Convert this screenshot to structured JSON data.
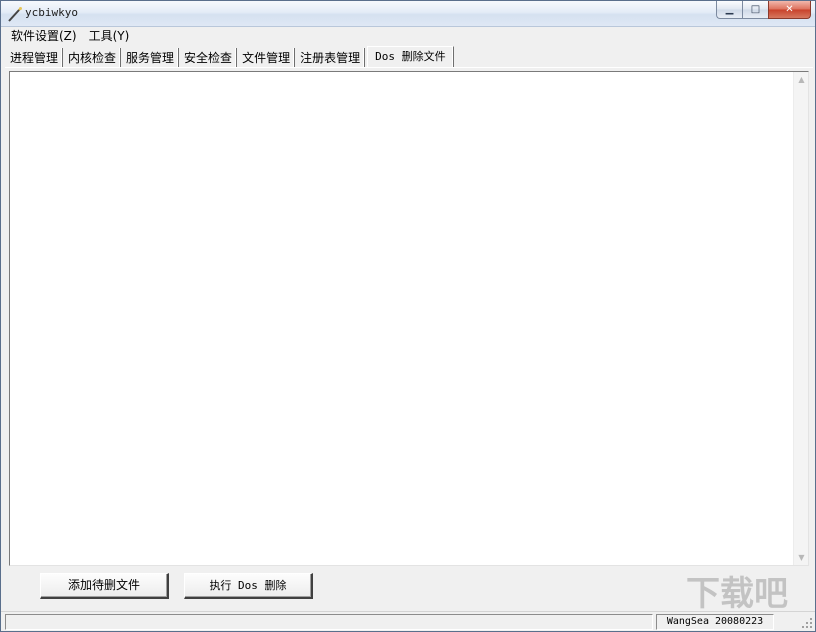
{
  "window": {
    "title": "ycbiwkyo",
    "accent": "#d5e1f0",
    "close_color": "#c8412a"
  },
  "caption_buttons": {
    "minimize_icon": "minimize-icon",
    "maximize_icon": "maximize-icon",
    "close_icon": "close-icon",
    "minimize_glyph": "▁",
    "maximize_glyph": "□",
    "close_glyph": "✕"
  },
  "menu": {
    "items": [
      {
        "label": "软件设置(Z)"
      },
      {
        "label": "工具(Y)"
      }
    ]
  },
  "tabs": [
    {
      "label": "进程管理"
    },
    {
      "label": "内核检查"
    },
    {
      "label": "服务管理"
    },
    {
      "label": "安全检查"
    },
    {
      "label": "文件管理"
    },
    {
      "label": "注册表管理"
    },
    {
      "label": "Dos 删除文件",
      "active": true
    }
  ],
  "actions": {
    "add_label": "添加待删文件",
    "execute_label": "执行 Dos 删除"
  },
  "watermark": {
    "text": "下载吧"
  },
  "status": {
    "left": "",
    "right": "WangSea 20080223"
  }
}
